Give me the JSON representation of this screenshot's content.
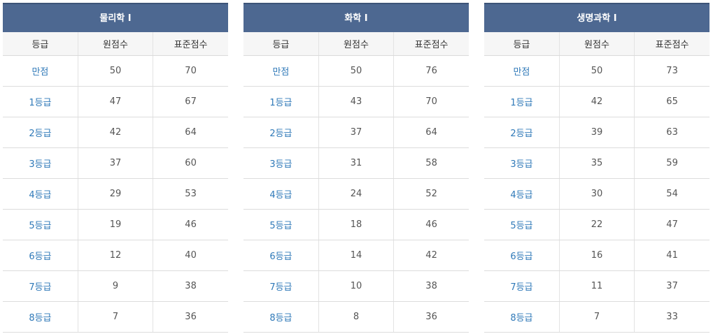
{
  "columns": [
    "등급",
    "원점수",
    "표준점수"
  ],
  "tables": [
    {
      "title": "물리학 I",
      "rows": [
        {
          "grade": "만점",
          "raw": "50",
          "std": "70"
        },
        {
          "grade": "1등급",
          "raw": "47",
          "std": "67"
        },
        {
          "grade": "2등급",
          "raw": "42",
          "std": "64"
        },
        {
          "grade": "3등급",
          "raw": "37",
          "std": "60"
        },
        {
          "grade": "4등급",
          "raw": "29",
          "std": "53"
        },
        {
          "grade": "5등급",
          "raw": "19",
          "std": "46"
        },
        {
          "grade": "6등급",
          "raw": "12",
          "std": "40"
        },
        {
          "grade": "7등급",
          "raw": "9",
          "std": "38"
        },
        {
          "grade": "8등급",
          "raw": "7",
          "std": "36"
        }
      ]
    },
    {
      "title": "화학 I",
      "rows": [
        {
          "grade": "만점",
          "raw": "50",
          "std": "76"
        },
        {
          "grade": "1등급",
          "raw": "43",
          "std": "70"
        },
        {
          "grade": "2등급",
          "raw": "37",
          "std": "64"
        },
        {
          "grade": "3등급",
          "raw": "31",
          "std": "58"
        },
        {
          "grade": "4등급",
          "raw": "24",
          "std": "52"
        },
        {
          "grade": "5등급",
          "raw": "18",
          "std": "46"
        },
        {
          "grade": "6등급",
          "raw": "14",
          "std": "42"
        },
        {
          "grade": "7등급",
          "raw": "10",
          "std": "38"
        },
        {
          "grade": "8등급",
          "raw": "8",
          "std": "36"
        }
      ]
    },
    {
      "title": "생명과학 I",
      "rows": [
        {
          "grade": "만점",
          "raw": "50",
          "std": "73"
        },
        {
          "grade": "1등급",
          "raw": "42",
          "std": "65"
        },
        {
          "grade": "2등급",
          "raw": "39",
          "std": "63"
        },
        {
          "grade": "3등급",
          "raw": "35",
          "std": "59"
        },
        {
          "grade": "4등급",
          "raw": "30",
          "std": "54"
        },
        {
          "grade": "5등급",
          "raw": "22",
          "std": "47"
        },
        {
          "grade": "6등급",
          "raw": "16",
          "std": "41"
        },
        {
          "grade": "7등급",
          "raw": "11",
          "std": "37"
        },
        {
          "grade": "8등급",
          "raw": "7",
          "std": "33"
        }
      ]
    }
  ],
  "colors": {
    "header_bg": "#4d6891",
    "header_text": "#ffffff",
    "grade_text": "#2f79b8",
    "value_text": "#555555"
  }
}
